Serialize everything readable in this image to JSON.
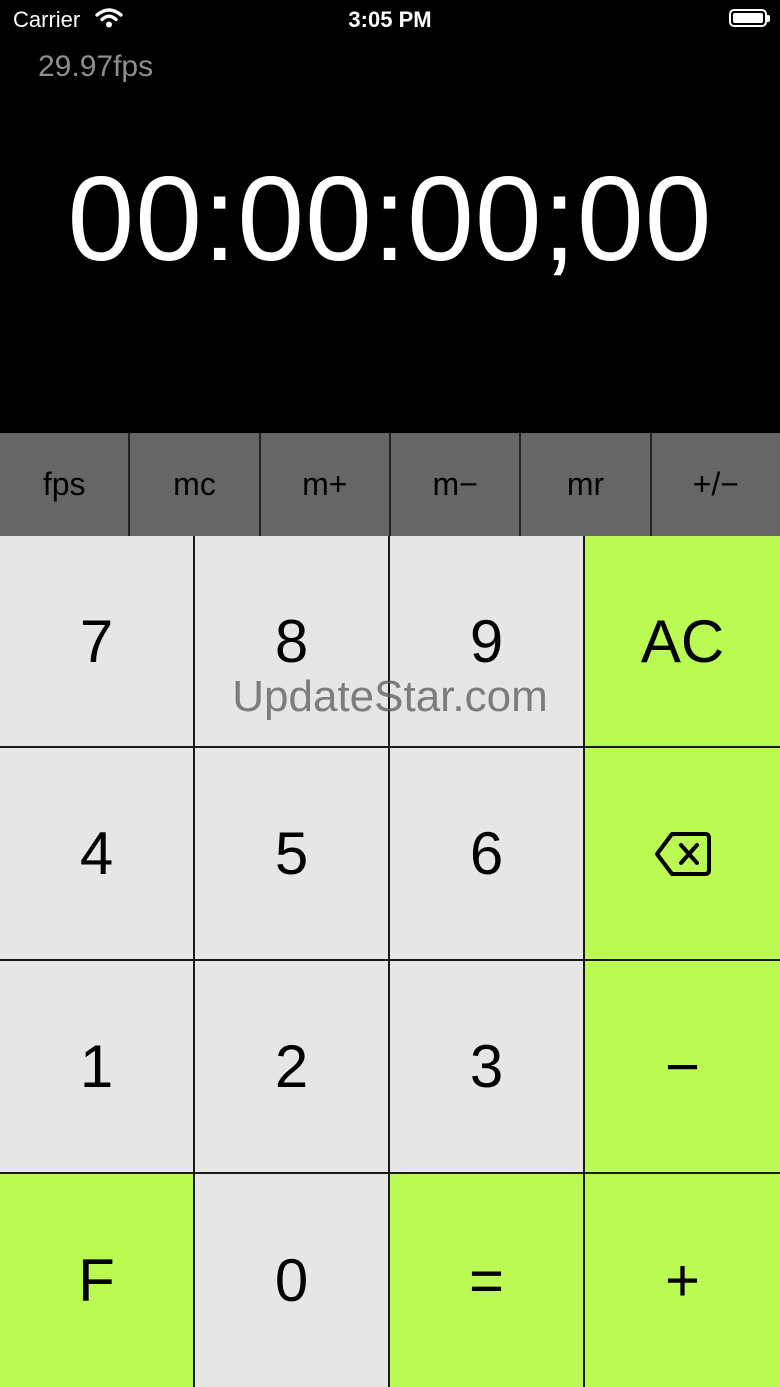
{
  "status_bar": {
    "carrier": "Carrier",
    "time": "3:05 PM"
  },
  "display": {
    "fps": "29.97fps",
    "timecode": "00:00:00;00"
  },
  "function_row": [
    "fps",
    "mc",
    "m+",
    "m−",
    "mr",
    "+/−"
  ],
  "keypad": {
    "k7": "7",
    "k8": "8",
    "k9": "9",
    "ac": "AC",
    "k4": "4",
    "k5": "5",
    "k6": "6",
    "k1": "1",
    "k2": "2",
    "k3": "3",
    "minus": "−",
    "f": "F",
    "k0": "0",
    "equals": "=",
    "plus": "+"
  },
  "watermark": "UpdateStar.com",
  "colors": {
    "accent": "#bbfa52",
    "key": "#e6e6e6",
    "function_row": "#666666"
  }
}
